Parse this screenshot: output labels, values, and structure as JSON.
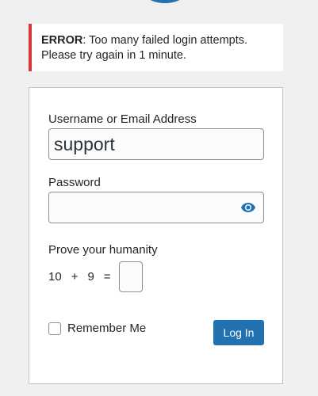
{
  "notice": {
    "label": "ERROR",
    "message": ": Too many failed login attempts. Please try again in 1 minute."
  },
  "form": {
    "username_label": "Username or Email Address",
    "username_value": "support",
    "password_label": "Password",
    "password_value": "",
    "captcha_label": "Prove your humanity",
    "captcha": {
      "a": "10",
      "op": "+",
      "b": "9",
      "eq": "="
    },
    "captcha_value": "",
    "remember_label": "Remember Me",
    "login_label": "Log In"
  },
  "colors": {
    "accent": "#2271b1",
    "error": "#d63638",
    "background": "#f0f0f1"
  },
  "icons": {
    "logo": "wordpress-logo-icon",
    "show_password": "eye-icon"
  }
}
